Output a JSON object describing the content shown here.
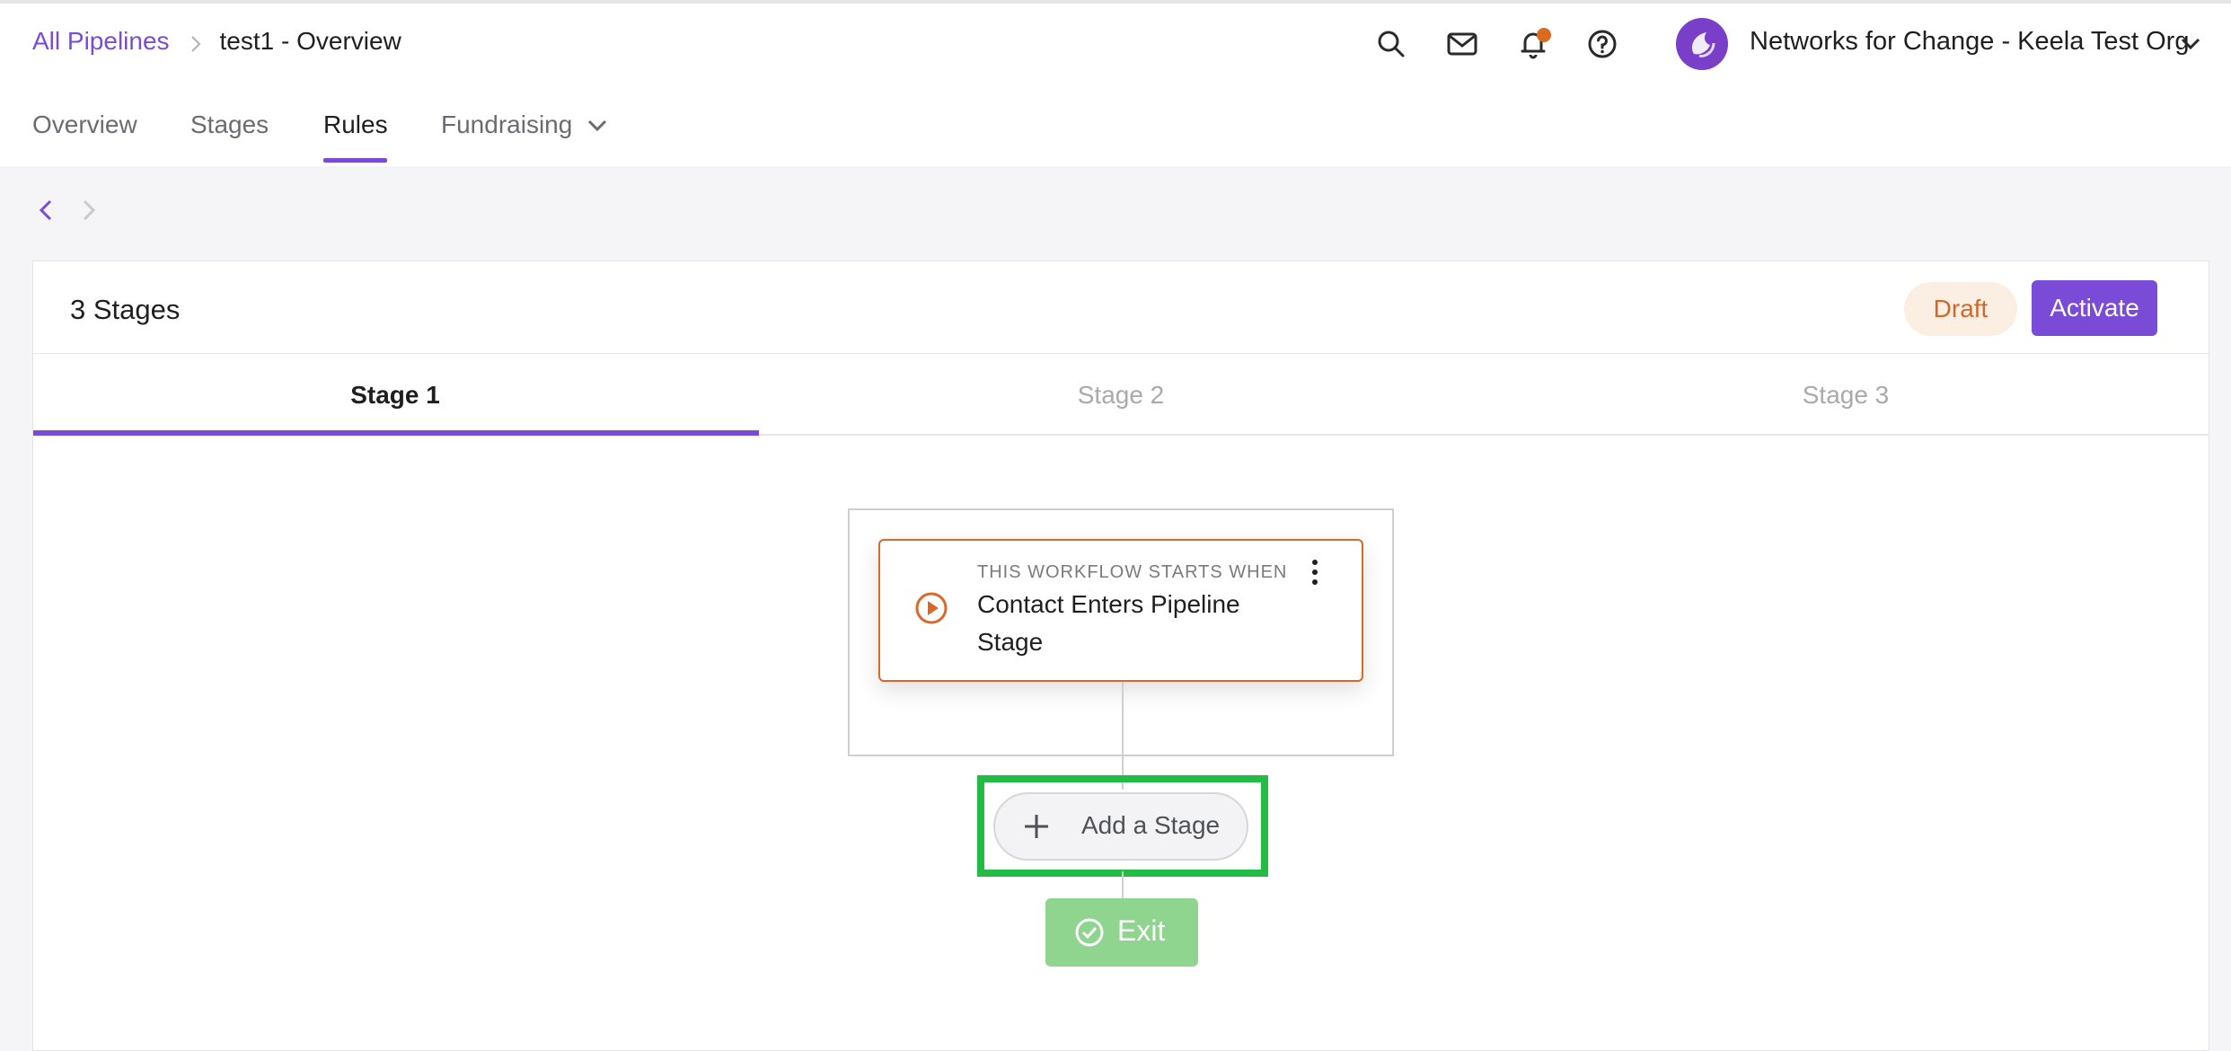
{
  "breadcrumb": {
    "root": "All Pipelines",
    "current": "test1 - Overview"
  },
  "org": {
    "name": "Networks for Change - Keela Test Org"
  },
  "nav": {
    "tabs": [
      "Overview",
      "Stages",
      "Rules",
      "Fundraising"
    ],
    "active": "Rules"
  },
  "panel": {
    "title": "3 Stages",
    "status_badge": "Draft",
    "activate_label": "Activate",
    "stage_tabs": [
      "Stage 1",
      "Stage 2",
      "Stage 3"
    ],
    "active_stage": "Stage 1"
  },
  "trigger": {
    "kicker": "THIS WORKFLOW STARTS WHEN",
    "title": "Contact Enters Pipeline Stage"
  },
  "actions": {
    "add_stage": "Add a Stage",
    "exit": "Exit"
  },
  "icons": [
    "search-icon",
    "mail-icon",
    "bell-icon",
    "help-icon",
    "chevron-down-icon",
    "play-circle-icon",
    "kebab-icon",
    "plus-icon",
    "check-circle-icon",
    "chevron-left-icon",
    "chevron-right-icon"
  ],
  "colors": {
    "accent": "#7a4bd6",
    "trigger": "#d9692b",
    "highlight": "#22bb44",
    "exit": "#8fd48f",
    "notification": "#d96a20"
  }
}
